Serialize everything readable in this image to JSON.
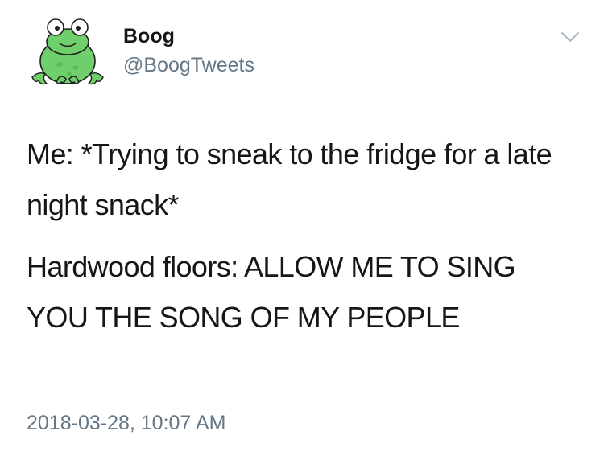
{
  "user": {
    "display_name": "Boog",
    "handle": "@BoogTweets",
    "avatar_icon": "frog-avatar-icon",
    "avatar_color": "#6fcf6c"
  },
  "tweet": {
    "paragraphs": [
      "Me: *Trying to sneak to the fridge for a late night snack*",
      "Hardwood floors: ALLOW ME TO SING YOU THE SONG OF MY PEOPLE"
    ],
    "timestamp": "2018-03-28, 10:07 AM"
  },
  "menu": {
    "icon": "chevron-down-icon"
  },
  "colors": {
    "text": "#14171a",
    "secondary": "#657786",
    "divider": "#d7dde1"
  }
}
